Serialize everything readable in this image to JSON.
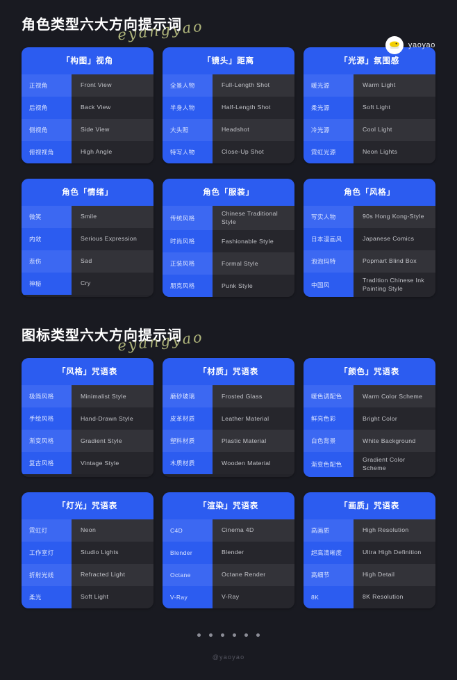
{
  "brand": {
    "name": "yaoyao",
    "logo_icon": "yaoyao-bird-logo"
  },
  "sections": [
    {
      "title": "角色类型六大方向提示词",
      "script_deco": "eyangyao",
      "cards": [
        {
          "header": "「构图」视角",
          "rows": [
            {
              "key": "正视角",
              "value": "Front View"
            },
            {
              "key": "后视角",
              "value": "Back View"
            },
            {
              "key": "侧视角",
              "value": "Side View"
            },
            {
              "key": "俯视视角",
              "value": "High Angle"
            }
          ]
        },
        {
          "header": "「镜头」距离",
          "rows": [
            {
              "key": "全景人物",
              "value": "Full-Length Shot"
            },
            {
              "key": "半身人物",
              "value": "Half-Length Shot"
            },
            {
              "key": "大头照",
              "value": "Headshot"
            },
            {
              "key": "特写人物",
              "value": "Close-Up Shot"
            }
          ]
        },
        {
          "header": "「光源」氛围感",
          "rows": [
            {
              "key": "暖光源",
              "value": "Warm Light"
            },
            {
              "key": "柔光源",
              "value": "Soft Light"
            },
            {
              "key": "冷光源",
              "value": "Cool Light"
            },
            {
              "key": "霓虹光源",
              "value": "Neon Lights"
            }
          ]
        },
        {
          "header": "角色「情绪」",
          "rows": [
            {
              "key": "微笑",
              "value": "Smile"
            },
            {
              "key": "内敛",
              "value": "Serious Expression"
            },
            {
              "key": "悲伤",
              "value": "Sad"
            },
            {
              "key": "神秘",
              "value": "Cry"
            }
          ]
        },
        {
          "header": "角色「服装」",
          "rows": [
            {
              "key": "传统风格",
              "value": "Chinese Traditional Style"
            },
            {
              "key": "时尚风格",
              "value": "Fashionable Style"
            },
            {
              "key": "正装风格",
              "value": "Formal Style"
            },
            {
              "key": "朋克风格",
              "value": "Punk Style"
            }
          ]
        },
        {
          "header": "角色「风格」",
          "rows": [
            {
              "key": "写实人物",
              "value": "90s Hong Kong-Style"
            },
            {
              "key": "日本漫画风",
              "value": "Japanese Comics"
            },
            {
              "key": "泡泡玛特",
              "value": "Popmart Blind Box"
            },
            {
              "key": "中国风",
              "value": "Tradition Chinese Ink Painting Style"
            }
          ]
        }
      ]
    },
    {
      "title": "图标类型六大方向提示词",
      "script_deco": "eyangyao",
      "cards": [
        {
          "header": "「风格」咒语表",
          "rows": [
            {
              "key": "极简风格",
              "value": "Minimalist Style"
            },
            {
              "key": "手绘风格",
              "value": "Hand-Drawn Style"
            },
            {
              "key": "渐变风格",
              "value": "Gradient Style"
            },
            {
              "key": "复古风格",
              "value": "Vintage Style"
            }
          ]
        },
        {
          "header": "「材质」咒语表",
          "rows": [
            {
              "key": "磨砂玻璃",
              "value": "Frosted Glass"
            },
            {
              "key": "皮革材质",
              "value": "Leather Material"
            },
            {
              "key": "塑料材质",
              "value": "Plastic Material"
            },
            {
              "key": "木质材质",
              "value": "Wooden Material"
            }
          ]
        },
        {
          "header": "「颜色」咒语表",
          "rows": [
            {
              "key": "暖色调配色",
              "value": "Warm Color Scheme"
            },
            {
              "key": "鲜亮色彩",
              "value": "Bright Color"
            },
            {
              "key": "白色背景",
              "value": "White Background"
            },
            {
              "key": "渐变色配色",
              "value": "Gradient Color Scheme"
            }
          ]
        },
        {
          "header": "「灯光」咒语表",
          "rows": [
            {
              "key": "霓虹灯",
              "value": "Neon"
            },
            {
              "key": "工作室灯",
              "value": "Studio Lights"
            },
            {
              "key": "折射光线",
              "value": "Refracted Light"
            },
            {
              "key": "柔光",
              "value": "Soft Light"
            }
          ]
        },
        {
          "header": "「渲染」咒语表",
          "rows": [
            {
              "key": "C4D",
              "value": "Cinema 4D"
            },
            {
              "key": "Blender",
              "value": "Blender"
            },
            {
              "key": "Octane",
              "value": "Octane Render"
            },
            {
              "key": "V-Ray",
              "value": "V-Ray"
            }
          ]
        },
        {
          "header": "「画质」咒语表",
          "rows": [
            {
              "key": "高画质",
              "value": "High Resolution"
            },
            {
              "key": "超高清晰度",
              "value": "Ultra High Definition"
            },
            {
              "key": "高细节",
              "value": "High Detail"
            },
            {
              "key": "8K",
              "value": "8K Resolution"
            }
          ]
        }
      ]
    }
  ],
  "footer": {
    "dots": 6,
    "active_dot": 0,
    "handle": "@yaoyao"
  },
  "colors": {
    "background": "#191a21",
    "accent_blue": "#2c5cf0",
    "accent_blue_light": "#3c68f2",
    "row_dark_a": "#333339",
    "row_dark_b": "#26262c",
    "deco_green": "#c9cf8a"
  }
}
